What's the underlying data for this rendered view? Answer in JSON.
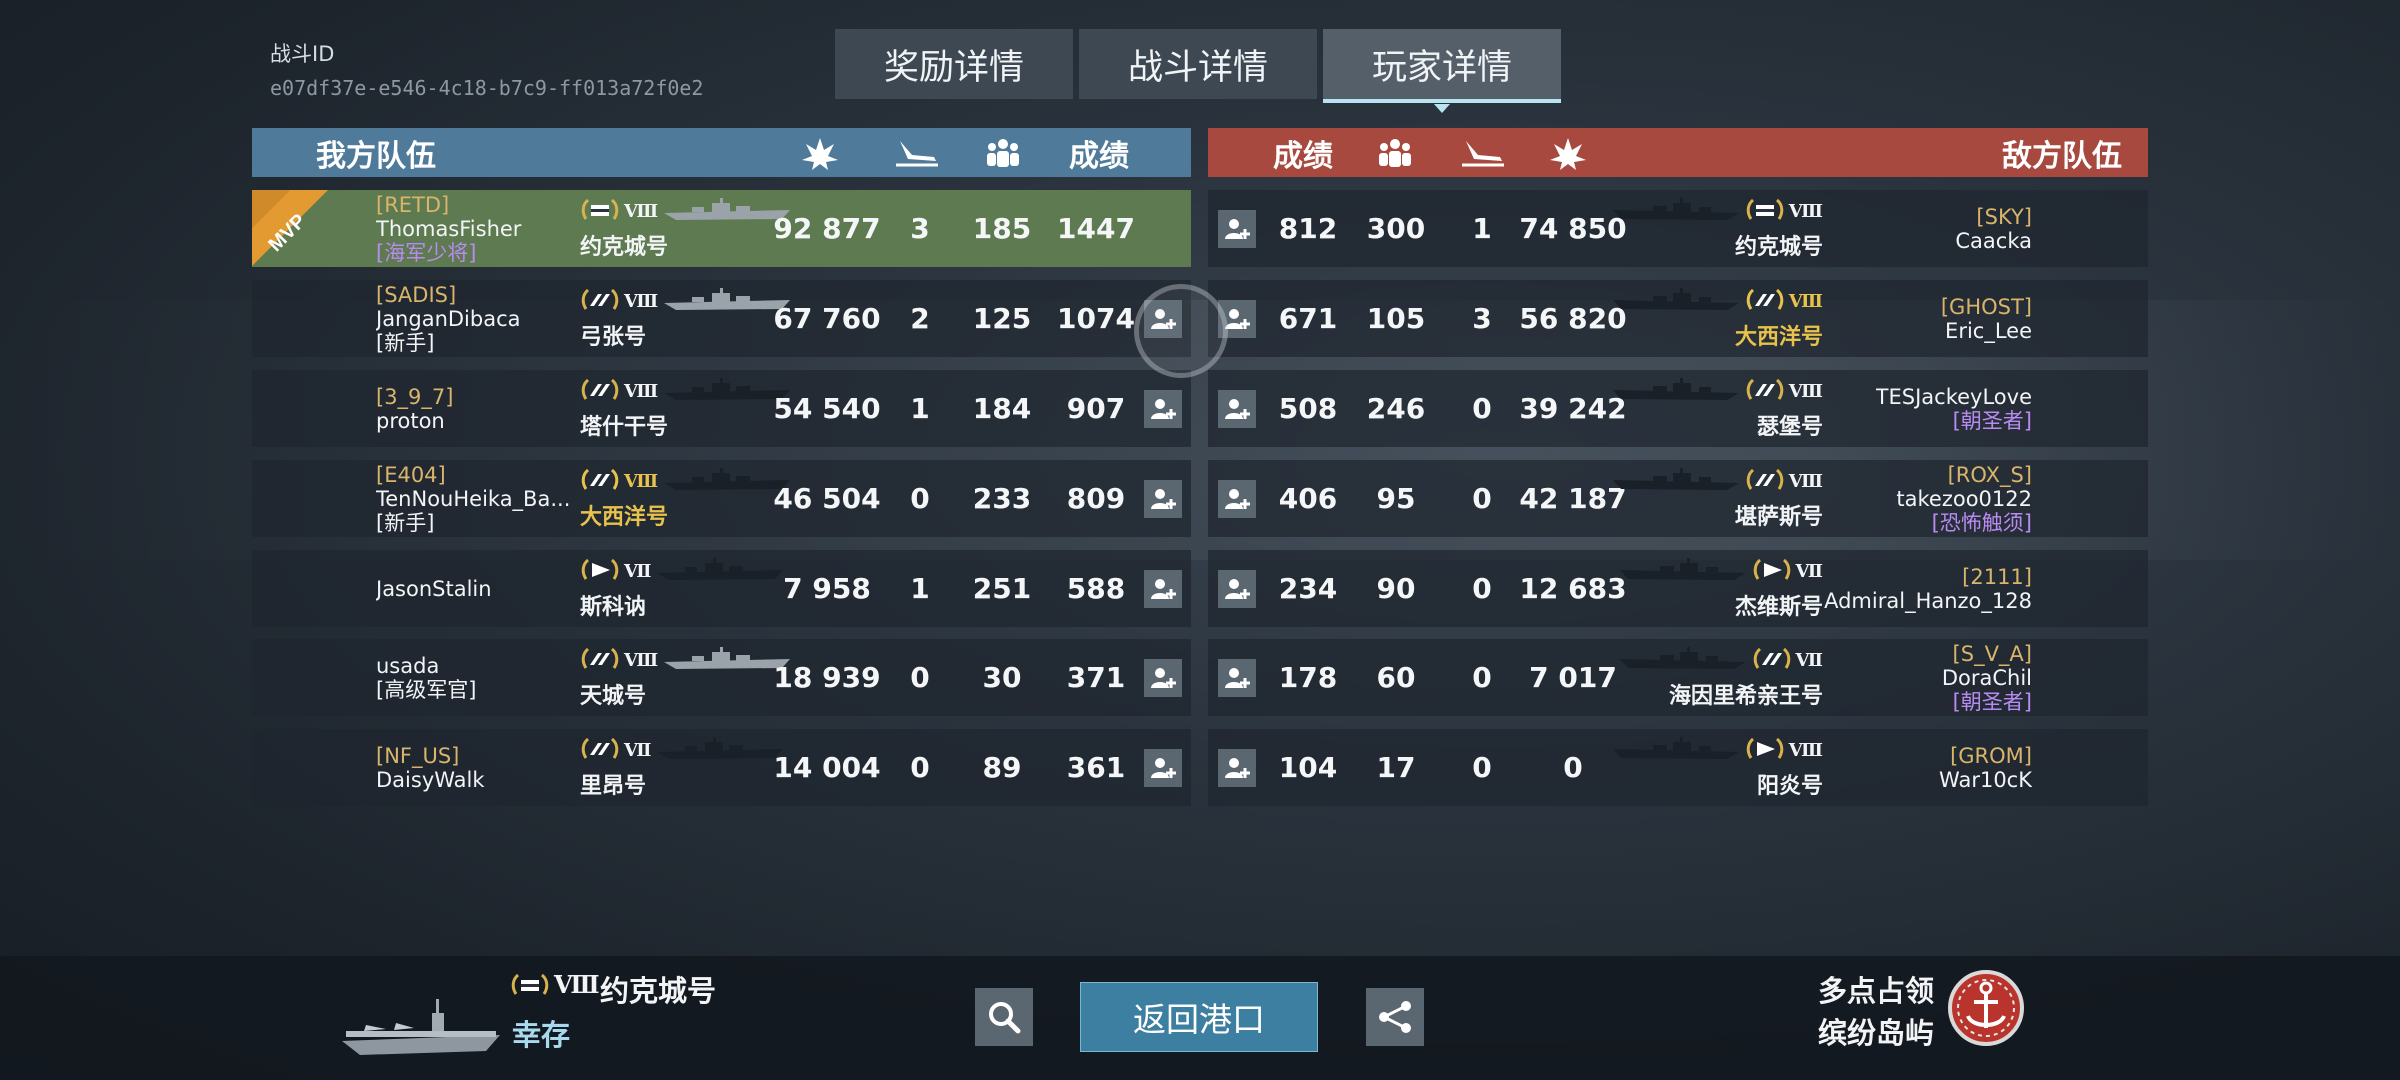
{
  "battle_id_label": "战斗ID",
  "battle_id": "e07df37e-e546-4c18-b7c9-ff013a72f0e2",
  "tabs": [
    "奖励详情",
    "战斗详情",
    "玩家详情"
  ],
  "active_tab": "玩家详情",
  "headers": {
    "our_team": "我方队伍",
    "enemy_team": "敌方队伍",
    "score": "成绩",
    "damage_icon": "explosion-icon",
    "kills_icon": "sinking-ship-icon",
    "assists_icon": "team-icon"
  },
  "colors": {
    "our_team_header": "#4f7a9a",
    "enemy_team_header": "#a8493f",
    "mvp_row": "#5e7a50",
    "clan_tag": "#d8b56a",
    "purple_title": "#b88bf0",
    "gold_ship": "#e8c24a",
    "active_tab_underline": "#b8e4f2"
  },
  "our_team": [
    {
      "clan": "[RETD]",
      "name": "ThomasFisher",
      "title": "[海军少将]",
      "ship_class": "carrier",
      "tier": "Ⅷ",
      "ship": "约克城号",
      "damage": "92 877",
      "kills": "3",
      "assists": "185",
      "score": "1447",
      "mvp": true
    },
    {
      "clan": "[SADIS]",
      "name": "JanganDibaca",
      "title": "[新手]",
      "ship_class": "battleship",
      "tier": "Ⅷ",
      "ship": "弓张号",
      "damage": "67 760",
      "kills": "2",
      "assists": "125",
      "score": "1074"
    },
    {
      "clan": "[3_9_7]",
      "name": "proton",
      "title": "",
      "ship_class": "battleship",
      "tier": "Ⅷ",
      "ship": "塔什干号",
      "damage": "54 540",
      "kills": "1",
      "assists": "184",
      "score": "907"
    },
    {
      "clan": "[E404]",
      "name": "TenNouHeika_Ba...",
      "title": "[新手]",
      "ship_class": "battleship",
      "tier": "Ⅷ",
      "ship": "大西洋号",
      "damage": "46 504",
      "kills": "0",
      "assists": "233",
      "score": "809",
      "ship_gold": true
    },
    {
      "clan": "",
      "name": "JasonStalin",
      "title": "",
      "ship_class": "destroyer",
      "tier": "Ⅶ",
      "ship": "斯科讷",
      "damage": "7 958",
      "kills": "1",
      "assists": "251",
      "score": "588"
    },
    {
      "clan": "",
      "name": "usada",
      "title": "[高级军官]",
      "ship_class": "battleship",
      "tier": "Ⅷ",
      "ship": "天城号",
      "damage": "18 939",
      "kills": "0",
      "assists": "30",
      "score": "371"
    },
    {
      "clan": "[NF_US]",
      "name": "DaisyWalk",
      "title": "",
      "ship_class": "battleship",
      "tier": "Ⅶ",
      "ship": "里昂号",
      "damage": "14 004",
      "kills": "0",
      "assists": "89",
      "score": "361"
    }
  ],
  "enemy_team": [
    {
      "clan": "[SKY]",
      "name": "Caacka",
      "title": "",
      "ship_class": "carrier",
      "tier": "Ⅷ",
      "ship": "约克城号",
      "damage": "74 850",
      "kills": "1",
      "assists": "300",
      "score": "812"
    },
    {
      "clan": "[GHOST]",
      "name": "Eric_Lee",
      "title": "",
      "ship_class": "battleship",
      "tier": "Ⅷ",
      "ship": "大西洋号",
      "damage": "56 820",
      "kills": "3",
      "assists": "105",
      "score": "671",
      "ship_gold": true,
      "tier_gold": true
    },
    {
      "clan": "",
      "name": "TESJackeyLove",
      "title": "[朝圣者]",
      "title_purple": true,
      "ship_class": "battleship",
      "tier": "Ⅷ",
      "ship": "瑟堡号",
      "damage": "39 242",
      "kills": "0",
      "assists": "246",
      "score": "508"
    },
    {
      "clan": "[ROX_S]",
      "name": "takezoo0122",
      "title": "[恐怖触须]",
      "title_purple": true,
      "ship_class": "battleship",
      "tier": "Ⅷ",
      "ship": "堪萨斯号",
      "damage": "42 187",
      "kills": "0",
      "assists": "95",
      "score": "406"
    },
    {
      "clan": "[2111]",
      "name": "Admiral_Hanzo_128",
      "title": "",
      "ship_class": "destroyer",
      "tier": "Ⅶ",
      "ship": "杰维斯号",
      "damage": "12 683",
      "kills": "0",
      "assists": "90",
      "score": "234"
    },
    {
      "clan": "[S_V_A]",
      "name": "DoraChil",
      "title": "[朝圣者]",
      "title_purple": true,
      "ship_class": "battleship",
      "tier": "Ⅶ",
      "ship": "海因里希亲王号",
      "damage": "7 017",
      "kills": "0",
      "assists": "60",
      "score": "178"
    },
    {
      "clan": "[GROM]",
      "name": "War10cK",
      "title": "",
      "ship_class": "destroyer",
      "tier": "Ⅷ",
      "ship": "阳炎号",
      "damage": "0",
      "kills": "0",
      "assists": "17",
      "score": "104"
    }
  ],
  "bottom": {
    "tier": "Ⅷ",
    "ship": "约克城号",
    "status": "幸存",
    "return_label": "返回港口",
    "mode": "多点占领",
    "map": "缤纷岛屿",
    "search_icon": "search-icon",
    "share_icon": "share-icon"
  }
}
